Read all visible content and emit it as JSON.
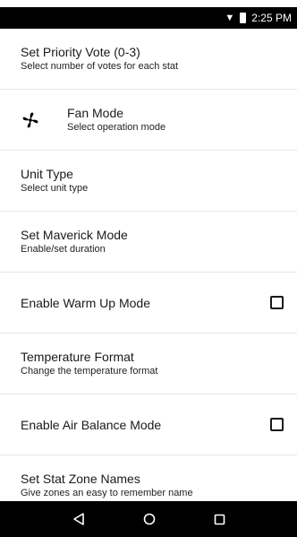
{
  "status_bar": {
    "time": "2:25 PM",
    "wifi_icon": "wifi-icon",
    "battery_icon": "battery-icon"
  },
  "settings": [
    {
      "title": "Set Priority Vote (0-3)",
      "subtitle": "Select number of votes for each stat"
    },
    {
      "title": "Fan Mode",
      "subtitle": "Select operation mode",
      "icon": "fan-icon"
    },
    {
      "title": "Unit Type",
      "subtitle": "Select unit type"
    },
    {
      "title": "Set Maverick Mode",
      "subtitle": "Enable/set duration"
    },
    {
      "title": "Enable Warm Up Mode",
      "checked": false
    },
    {
      "title": "Temperature Format",
      "subtitle": "Change the temperature format"
    },
    {
      "title": "Enable Air Balance Mode",
      "checked": false
    },
    {
      "title": "Set Stat Zone Names",
      "subtitle": "Give zones an easy to remember name"
    }
  ],
  "nav_bar": {
    "back_icon": "back-icon",
    "home_icon": "home-icon",
    "recents_icon": "recents-icon"
  },
  "colors": {
    "status_bar": "#000000",
    "nav_bar": "#000000",
    "text": "#1a1a1a",
    "divider": "#e6e6e6"
  }
}
